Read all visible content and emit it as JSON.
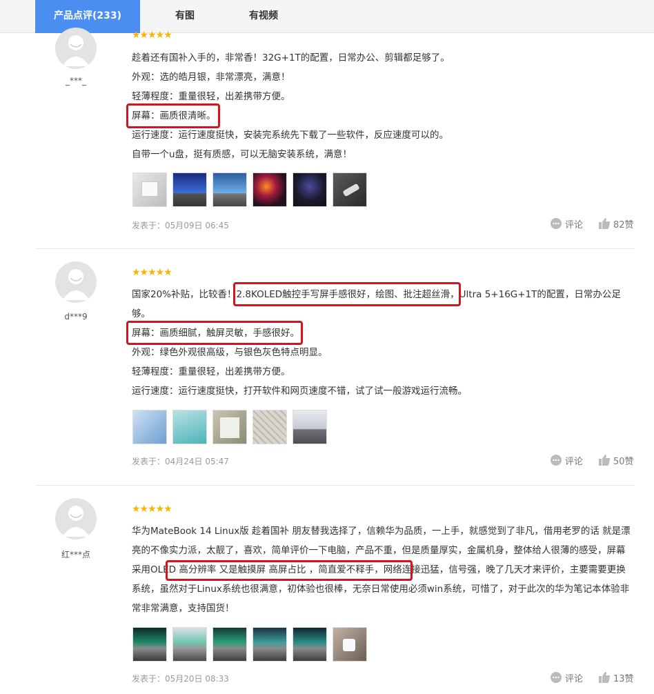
{
  "tabs": [
    {
      "label": "产品点评(233)"
    },
    {
      "label": "有图"
    },
    {
      "label": "有视频"
    }
  ],
  "accent_color": "#4a8ef2",
  "highlight_color": "#d3141c",
  "star_color": "#f7b500",
  "reviews": [
    {
      "user": "_***_",
      "rating": 5,
      "stars": "★★★★★",
      "lines": [
        "趁着还有国补入手的，非常香！32G+1T的配置，日常办公、剪辑都足够了。",
        "外观：选的皓月银，非常漂亮，满意！",
        "轻薄程度：重量很轻，出差携带方便。",
        "屏幕：画质很清晰。",
        "运行速度：运行速度挺快，安装完系统先下载了一些软件，反应速度可以的。",
        "自带一个u盘，挺有质感，可以无脑安装系统，满意！"
      ],
      "thumbnails": [
        "silver laptop box",
        "laptop with blue desktop",
        "laptop screen with wave wallpaper",
        "laptop with colorful wallpaper",
        "laptop on dark desk",
        "usb drive"
      ],
      "date": "发表于：05月09日 06:45",
      "comment_label": "评论",
      "likes_label": "82赞"
    },
    {
      "user": "d***9",
      "rating": 5,
      "stars": "★★★★★",
      "text": "国家20%补贴，比较香！2.8KOLED触控手写屏手感很好，绘图、批注超丝滑，Ultra 5+16G+1T的配置，日常办公足够。",
      "lines": [
        "屏幕：画质细腻，触屏灵敏，手感很好。",
        "外观：绿色外观很高级，与银色灰色特点明显。",
        "轻薄程度：重量很轻，出差携带方便。",
        "运行速度：运行速度挺快，打开软件和网页速度不错，试了试一般游戏运行流畅。"
      ],
      "thumbnails": [
        "screen with document",
        "green laptop",
        "laptop packaging",
        "keyboard closeup",
        "laptop screen"
      ],
      "date": "发表于：04月24日 05:47",
      "comment_label": "评论",
      "likes_label": "50赞"
    },
    {
      "user": "红***点",
      "rating": 5,
      "stars": "★★★★★",
      "text": "华为MateBook 14 Linux版 趁着国补 朋友替我选择了，信赖华为品质，一上手，就感觉到了非凡，借用老罗的话 就是漂亮的不像实力派，太靓了，喜欢，简单评价一下电脑，产品不重，但是质量厚实，金属机身，整体给人很薄的感受，屏幕采用OLED 高分辨率 又是触摸屏 高屏占比 ，简直爱不释手，网络连接迅猛，信号强，晚了几天才来评价，主要需要更换系统，虽然对于Linux系统也很满意，初体验也很棒，无奈日常使用必须win系统，可惜了，对于此次的华为笔记本体验非常非常满意，支持国货！",
      "thumbnails": [
        "laptop with aurora wallpaper",
        "laptop with aurora wallpaper",
        "laptop with aurora wallpaper",
        "laptop with aurora wallpaper",
        "laptop with aurora wallpaper",
        "accessories on desk"
      ],
      "date": "发表于：05月20日 08:33",
      "comment_label": "评论",
      "likes_label": "13赞"
    }
  ]
}
